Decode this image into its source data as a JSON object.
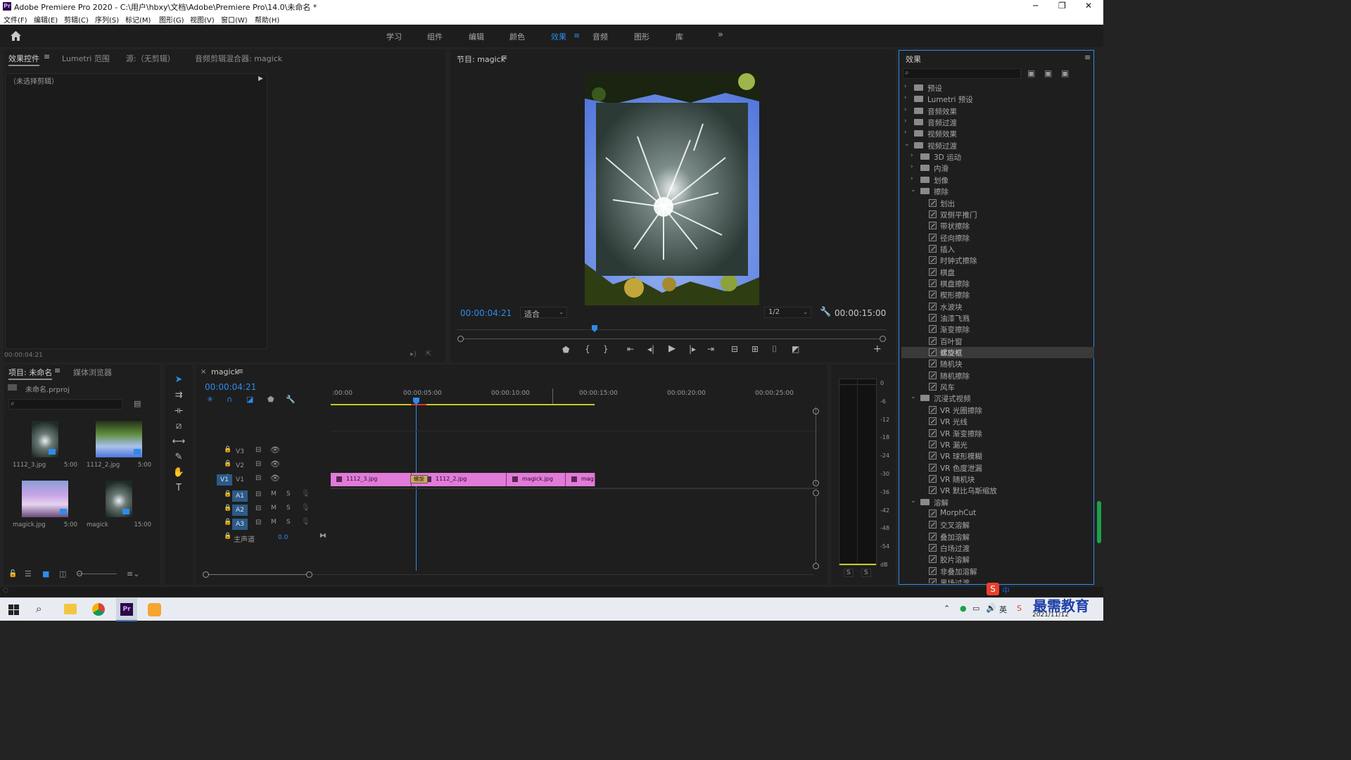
{
  "window": {
    "title": "Adobe Premiere Pro 2020 - C:\\用户\\hbxy\\文档\\Adobe\\Premiere Pro\\14.0\\未命名 *",
    "app_icon": "Pr",
    "minimize": "─",
    "maximize": "❐",
    "close": "✕"
  },
  "menu": [
    "文件(F)",
    "编辑(E)",
    "剪辑(C)",
    "序列(S)",
    "标记(M)",
    "图形(G)",
    "视图(V)",
    "窗口(W)",
    "帮助(H)"
  ],
  "workspaces": {
    "items": [
      "学习",
      "组件",
      "编辑",
      "颜色",
      "效果",
      "音频",
      "图形",
      "库"
    ],
    "active": "效果",
    "more": "»"
  },
  "source_panel": {
    "tabs": [
      "效果控件",
      "Lumetri 范围",
      "源:（无剪辑）",
      "音频剪辑混合器: magick"
    ],
    "no_clip": "（未选择剪辑）",
    "timecode": "00:00:04:21"
  },
  "program_monitor": {
    "title": "节目: magick",
    "timecode": "00:00:04:21",
    "fit": "适合",
    "resolution": "1/2",
    "duration": "00:00:15:00",
    "playhead_fraction": 0.32
  },
  "project_panel": {
    "tabs": [
      "项目: 未命名",
      "媒体浏览器"
    ],
    "file": "未命名.prproj",
    "items": [
      {
        "name": "1112_3.jpg",
        "duration": "5:00"
      },
      {
        "name": "1112_2.jpg",
        "duration": "5:00"
      },
      {
        "name": "magick.jpg",
        "duration": "5:00"
      },
      {
        "name": "magick",
        "duration": "15:00"
      }
    ]
  },
  "timeline": {
    "sequence": "magick",
    "timecode": "00:00:04:21",
    "ruler": [
      ":00:00",
      "00:00:05:00",
      "00:00:10:00",
      "00:00:15:00",
      "00:00:20:00",
      "00:00:25:00"
    ],
    "video_tracks": [
      "V3",
      "V2",
      "V1"
    ],
    "audio_tracks": [
      "A1",
      "A2",
      "A3"
    ],
    "master": "主声道",
    "master_value": "0.0",
    "clips": [
      "1112_3.jpg",
      "1112_2.jpg",
      "magick.jpg",
      "mag"
    ],
    "transition_label": "螺旋"
  },
  "meter": {
    "scale": [
      "0",
      "-6",
      "-12",
      "-18",
      "-24",
      "-30",
      "-36",
      "-42",
      "-48",
      "-54",
      "dB"
    ],
    "solo": [
      "S",
      "S"
    ]
  },
  "effects_panel": {
    "title": "效果",
    "tree": [
      {
        "label": "预设",
        "level": 0,
        "kind": "folder",
        "open": false
      },
      {
        "label": "Lumetri 预设",
        "level": 0,
        "kind": "folder",
        "open": false
      },
      {
        "label": "音频效果",
        "level": 0,
        "kind": "folder",
        "open": false
      },
      {
        "label": "音频过渡",
        "level": 0,
        "kind": "folder",
        "open": false
      },
      {
        "label": "视频效果",
        "level": 0,
        "kind": "folder",
        "open": false
      },
      {
        "label": "视频过渡",
        "level": 0,
        "kind": "folder",
        "open": true
      },
      {
        "label": "3D 运动",
        "level": 1,
        "kind": "folder",
        "open": false
      },
      {
        "label": "内滑",
        "level": 1,
        "kind": "folder",
        "open": false
      },
      {
        "label": "划像",
        "level": 1,
        "kind": "folder",
        "open": false
      },
      {
        "label": "擦除",
        "level": 1,
        "kind": "folder",
        "open": true
      },
      {
        "label": "划出",
        "level": 2,
        "kind": "fx"
      },
      {
        "label": "双侧平推门",
        "level": 2,
        "kind": "fx"
      },
      {
        "label": "带状擦除",
        "level": 2,
        "kind": "fx"
      },
      {
        "label": "径向擦除",
        "level": 2,
        "kind": "fx"
      },
      {
        "label": "插入",
        "level": 2,
        "kind": "fx"
      },
      {
        "label": "时钟式擦除",
        "level": 2,
        "kind": "fx"
      },
      {
        "label": "棋盘",
        "level": 2,
        "kind": "fx"
      },
      {
        "label": "棋盘擦除",
        "level": 2,
        "kind": "fx"
      },
      {
        "label": "楔形擦除",
        "level": 2,
        "kind": "fx"
      },
      {
        "label": "水波块",
        "level": 2,
        "kind": "fx"
      },
      {
        "label": "油漆飞溅",
        "level": 2,
        "kind": "fx"
      },
      {
        "label": "渐变擦除",
        "level": 2,
        "kind": "fx"
      },
      {
        "label": "百叶窗",
        "level": 2,
        "kind": "fx"
      },
      {
        "label": "螺旋框",
        "level": 2,
        "kind": "fx",
        "selected": true
      },
      {
        "label": "随机块",
        "level": 2,
        "kind": "fx"
      },
      {
        "label": "随机擦除",
        "level": 2,
        "kind": "fx"
      },
      {
        "label": "风车",
        "level": 2,
        "kind": "fx"
      },
      {
        "label": "沉浸式视频",
        "level": 1,
        "kind": "folder",
        "open": true
      },
      {
        "label": "VR 光圈擦除",
        "level": 2,
        "kind": "fx"
      },
      {
        "label": "VR 光线",
        "level": 2,
        "kind": "fx"
      },
      {
        "label": "VR 渐变擦除",
        "level": 2,
        "kind": "fx"
      },
      {
        "label": "VR 漏光",
        "level": 2,
        "kind": "fx"
      },
      {
        "label": "VR 球形模糊",
        "level": 2,
        "kind": "fx"
      },
      {
        "label": "VR 色度泄漏",
        "level": 2,
        "kind": "fx"
      },
      {
        "label": "VR 随机块",
        "level": 2,
        "kind": "fx"
      },
      {
        "label": "VR 默比乌斯缩放",
        "level": 2,
        "kind": "fx"
      },
      {
        "label": "溶解",
        "level": 1,
        "kind": "folder",
        "open": true
      },
      {
        "label": "MorphCut",
        "level": 2,
        "kind": "fx"
      },
      {
        "label": "交叉溶解",
        "level": 2,
        "kind": "fx"
      },
      {
        "label": "叠加溶解",
        "level": 2,
        "kind": "fx"
      },
      {
        "label": "白场过渡",
        "level": 2,
        "kind": "fx"
      },
      {
        "label": "胶片溶解",
        "level": 2,
        "kind": "fx"
      },
      {
        "label": "非叠加溶解",
        "level": 2,
        "kind": "fx"
      },
      {
        "label": "黑场过渡",
        "level": 2,
        "kind": "fx"
      }
    ]
  },
  "taskbar": {
    "time": "2021/11/12",
    "watermark": "最需教育",
    "ime": "中"
  },
  "colors": {
    "accent": "#2d8ceb",
    "clip": "#e27ad9",
    "panel": "#1e1e1e"
  }
}
